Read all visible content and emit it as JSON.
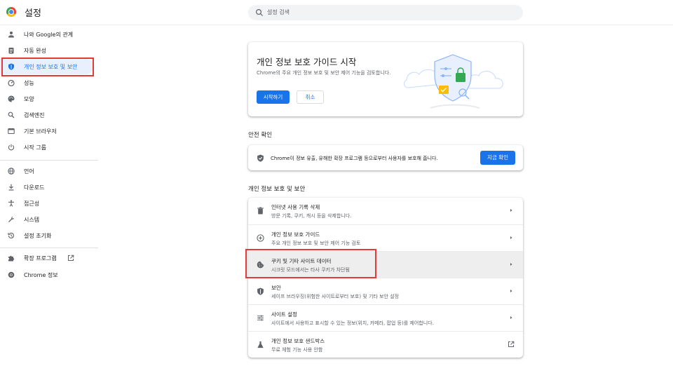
{
  "app": {
    "title": "설정"
  },
  "search": {
    "placeholder": "설정 검색"
  },
  "sidebar": {
    "items": [
      {
        "label": "나와 Google의 관계",
        "icon": "person-icon"
      },
      {
        "label": "자동 완성",
        "icon": "clipboard-icon"
      },
      {
        "label": "개인 정보 보호 및 보안",
        "icon": "shield-icon",
        "active": true
      },
      {
        "label": "성능",
        "icon": "speedometer-icon"
      },
      {
        "label": "모양",
        "icon": "palette-icon"
      },
      {
        "label": "검색엔진",
        "icon": "search-icon"
      },
      {
        "label": "기본 브라우저",
        "icon": "browser-icon"
      },
      {
        "label": "시작 그룹",
        "icon": "power-icon"
      },
      {
        "label": "언어",
        "icon": "globe-icon"
      },
      {
        "label": "다운로드",
        "icon": "download-icon"
      },
      {
        "label": "접근성",
        "icon": "accessibility-icon"
      },
      {
        "label": "시스템",
        "icon": "wrench-icon"
      },
      {
        "label": "설정 초기화",
        "icon": "reset-icon"
      },
      {
        "label": "확장 프로그램",
        "icon": "puzzle-icon"
      },
      {
        "label": "Chrome 정보",
        "icon": "chrome-icon"
      }
    ]
  },
  "guide": {
    "title": "개인 정보 보호 가이드 시작",
    "description": "Chrome의 주요 개인 정보 보호 및 보안 제어 기능을 검토합니다.",
    "start_button": "시작하기",
    "cancel_button": "취소"
  },
  "safety_check": {
    "section_title": "안전 확인",
    "text": "Chrome이 정보 유출, 유해한 확장 프로그램 등으로부터 사용자를 보호해 줍니다.",
    "button": "지금 확인"
  },
  "privacy": {
    "section_title": "개인 정보 보호 및 보안",
    "rows": [
      {
        "title": "인터넷 사용 기록 삭제",
        "subtitle": "방문 기록, 쿠키, 캐시 등을 삭제합니다.",
        "icon": "trash-icon",
        "trailing": "chevron-right-icon"
      },
      {
        "title": "개인 정보 보호 가이드",
        "subtitle": "주요 개인 정보 보호 및 보안 제어 기능 검토",
        "icon": "add-circle-icon",
        "trailing": "chevron-right-icon"
      },
      {
        "title": "쿠키 및 기타 사이트 데이터",
        "subtitle": "시크릿 모드에서는 타사 쿠키가 차단됨",
        "icon": "cookie-icon",
        "trailing": "chevron-right-icon"
      },
      {
        "title": "보안",
        "subtitle": "세이프 브라우징(위험한 사이트로부터 보호) 및 기타 보안 설정",
        "icon": "shield-icon",
        "trailing": "chevron-right-icon"
      },
      {
        "title": "사이트 설정",
        "subtitle": "사이트에서 사용하고 표시할 수 있는 정보(위치, 카메라, 팝업 등)를 제어합니다.",
        "icon": "tune-icon",
        "trailing": "chevron-right-icon"
      },
      {
        "title": "개인 정보 보호 샌드박스",
        "subtitle": "무료 체험 기능 사용 안함",
        "icon": "flask-icon",
        "trailing": "external-link-icon"
      }
    ]
  },
  "colors": {
    "accent": "#1a73e8",
    "highlight": "#e53935",
    "active_bg": "#e8f0fe"
  }
}
